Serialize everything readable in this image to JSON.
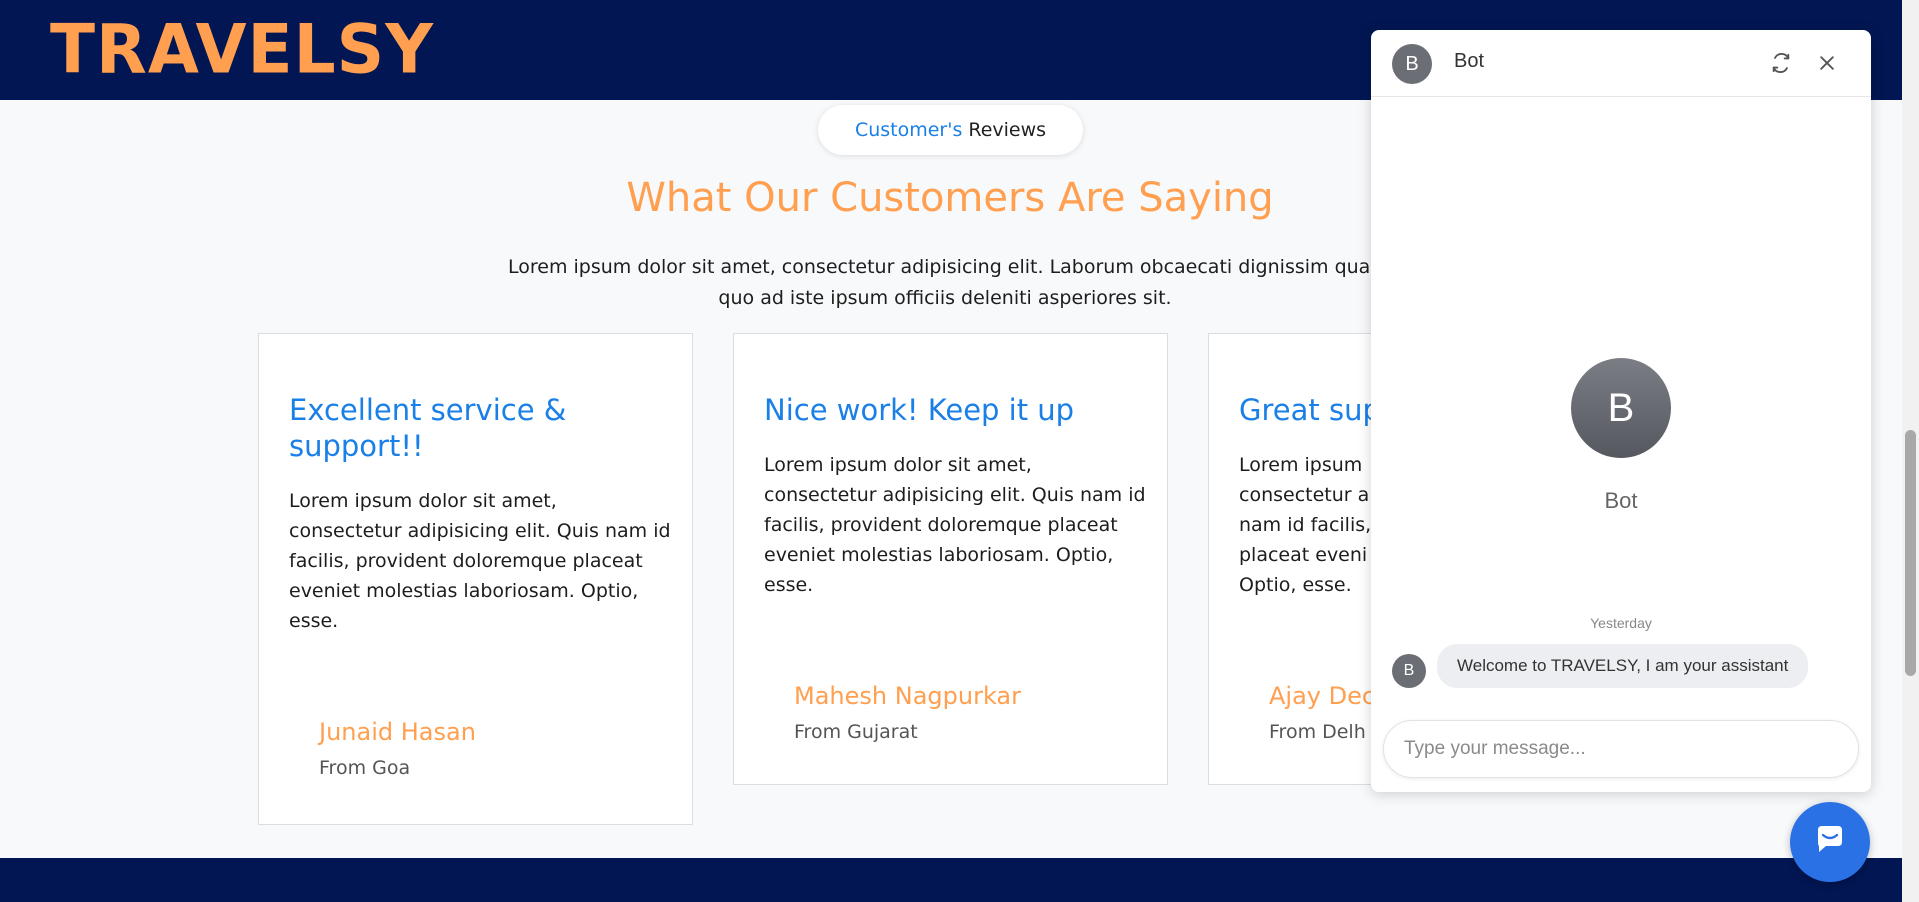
{
  "header": {
    "logo": "TRAVELSY"
  },
  "section": {
    "pill_part1": "Customer's",
    "pill_part2": "Reviews",
    "heading": "What Our Customers Are Saying",
    "subtext": "Lorem ipsum dolor sit amet, consectetur adipisicing elit. Laborum obcaecati dignissim quae quo ad iste ipsum officiis deleniti asperiores sit."
  },
  "reviews": [
    {
      "title": "Excellent service & support!!",
      "text": "Lorem ipsum dolor sit amet, consectetur adipisicing elit. Quis nam id facilis, provident doloremque placeat eveniet molestias laboriosam. Optio, esse.",
      "author": "Junaid Hasan",
      "from": "From Goa"
    },
    {
      "title": "Nice work! Keep it up",
      "text": "Lorem ipsum dolor sit amet, consectetur adipisicing elit. Quis nam id facilis, provident doloremque placeat eveniet molestias laboriosam. Optio, esse.",
      "author": "Mahesh Nagpurkar",
      "from": "From Gujarat"
    },
    {
      "title": "Great sup",
      "text": "Lorem ipsum consectetur a nam id facilis, placeat eveni Optio, esse.",
      "author": "Ajay Dec",
      "from": "From Delh"
    }
  ],
  "chat": {
    "avatar_letter": "B",
    "bot_name": "Bot",
    "refresh_icon": "refresh-icon",
    "close_icon": "close-icon",
    "date_label": "Yesterday",
    "message": "Welcome to TRAVELSY, I am your assistant",
    "input_placeholder": "Type your message...",
    "launcher_icon": "chat-bubble-icon"
  },
  "colors": {
    "navy": "#021653",
    "orange": "#ff9f4f",
    "blue": "#1a7fe6",
    "launcher": "#2a71e6"
  }
}
